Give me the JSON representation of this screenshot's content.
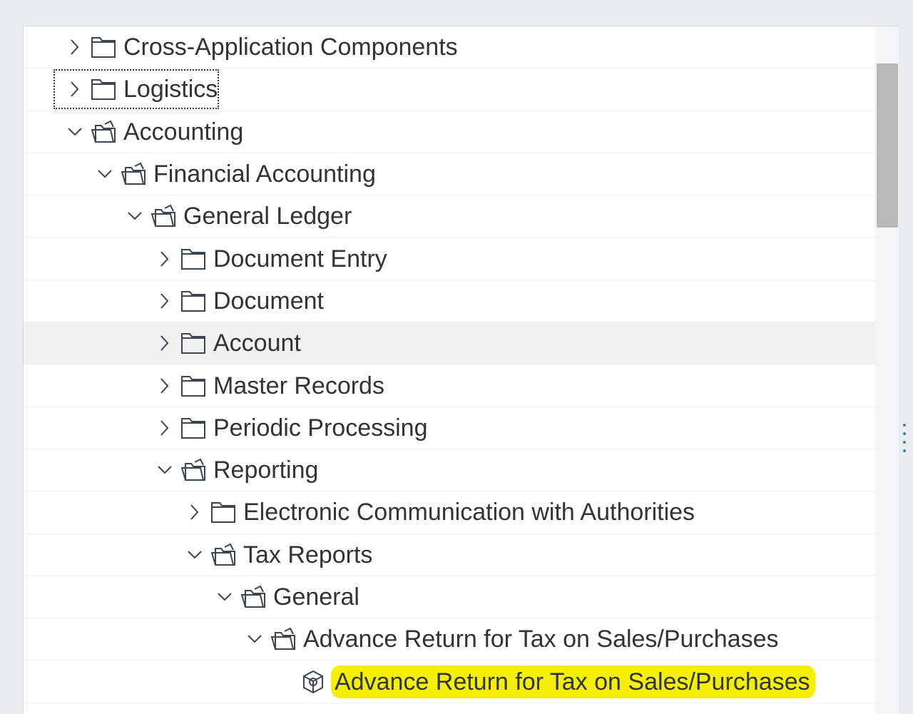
{
  "tree": {
    "rows": [
      {
        "label": "Cross-Application Components",
        "level": 0,
        "state": "collapsed",
        "icon": "folder-closed-icon"
      },
      {
        "label": "Logistics",
        "level": 0,
        "state": "collapsed",
        "icon": "folder-closed-icon",
        "focused": true
      },
      {
        "label": "Accounting",
        "level": 0,
        "state": "expanded",
        "icon": "folder-open-icon"
      },
      {
        "label": "Financial Accounting",
        "level": 1,
        "state": "expanded",
        "icon": "folder-open-icon"
      },
      {
        "label": "General Ledger",
        "level": 2,
        "state": "expanded",
        "icon": "folder-open-icon"
      },
      {
        "label": "Document Entry",
        "level": 3,
        "state": "collapsed",
        "icon": "folder-closed-icon"
      },
      {
        "label": "Document",
        "level": 3,
        "state": "collapsed",
        "icon": "folder-closed-icon"
      },
      {
        "label": "Account",
        "level": 3,
        "state": "collapsed",
        "icon": "folder-closed-icon",
        "hovered": true
      },
      {
        "label": "Master Records",
        "level": 3,
        "state": "collapsed",
        "icon": "folder-closed-icon"
      },
      {
        "label": "Periodic Processing",
        "level": 3,
        "state": "collapsed",
        "icon": "folder-closed-icon"
      },
      {
        "label": "Reporting",
        "level": 3,
        "state": "expanded",
        "icon": "folder-open-icon"
      },
      {
        "label": "Electronic Communication with Authorities",
        "level": 4,
        "state": "collapsed",
        "icon": "folder-closed-icon"
      },
      {
        "label": "Tax Reports",
        "level": 4,
        "state": "expanded",
        "icon": "folder-open-icon"
      },
      {
        "label": "General",
        "level": 5,
        "state": "expanded",
        "icon": "folder-open-icon"
      },
      {
        "label": "Advance Return for Tax on Sales/Purchases",
        "level": 6,
        "state": "expanded",
        "icon": "folder-open-icon"
      },
      {
        "label": "Advance Return for Tax on Sales/Purchases",
        "level": 7,
        "state": "leaf",
        "icon": "transaction-cube-icon",
        "highlighted": true
      }
    ]
  },
  "colors": {
    "highlight": "#f5f000",
    "icon_stroke": "#3a4550",
    "text": "#2f3438"
  }
}
